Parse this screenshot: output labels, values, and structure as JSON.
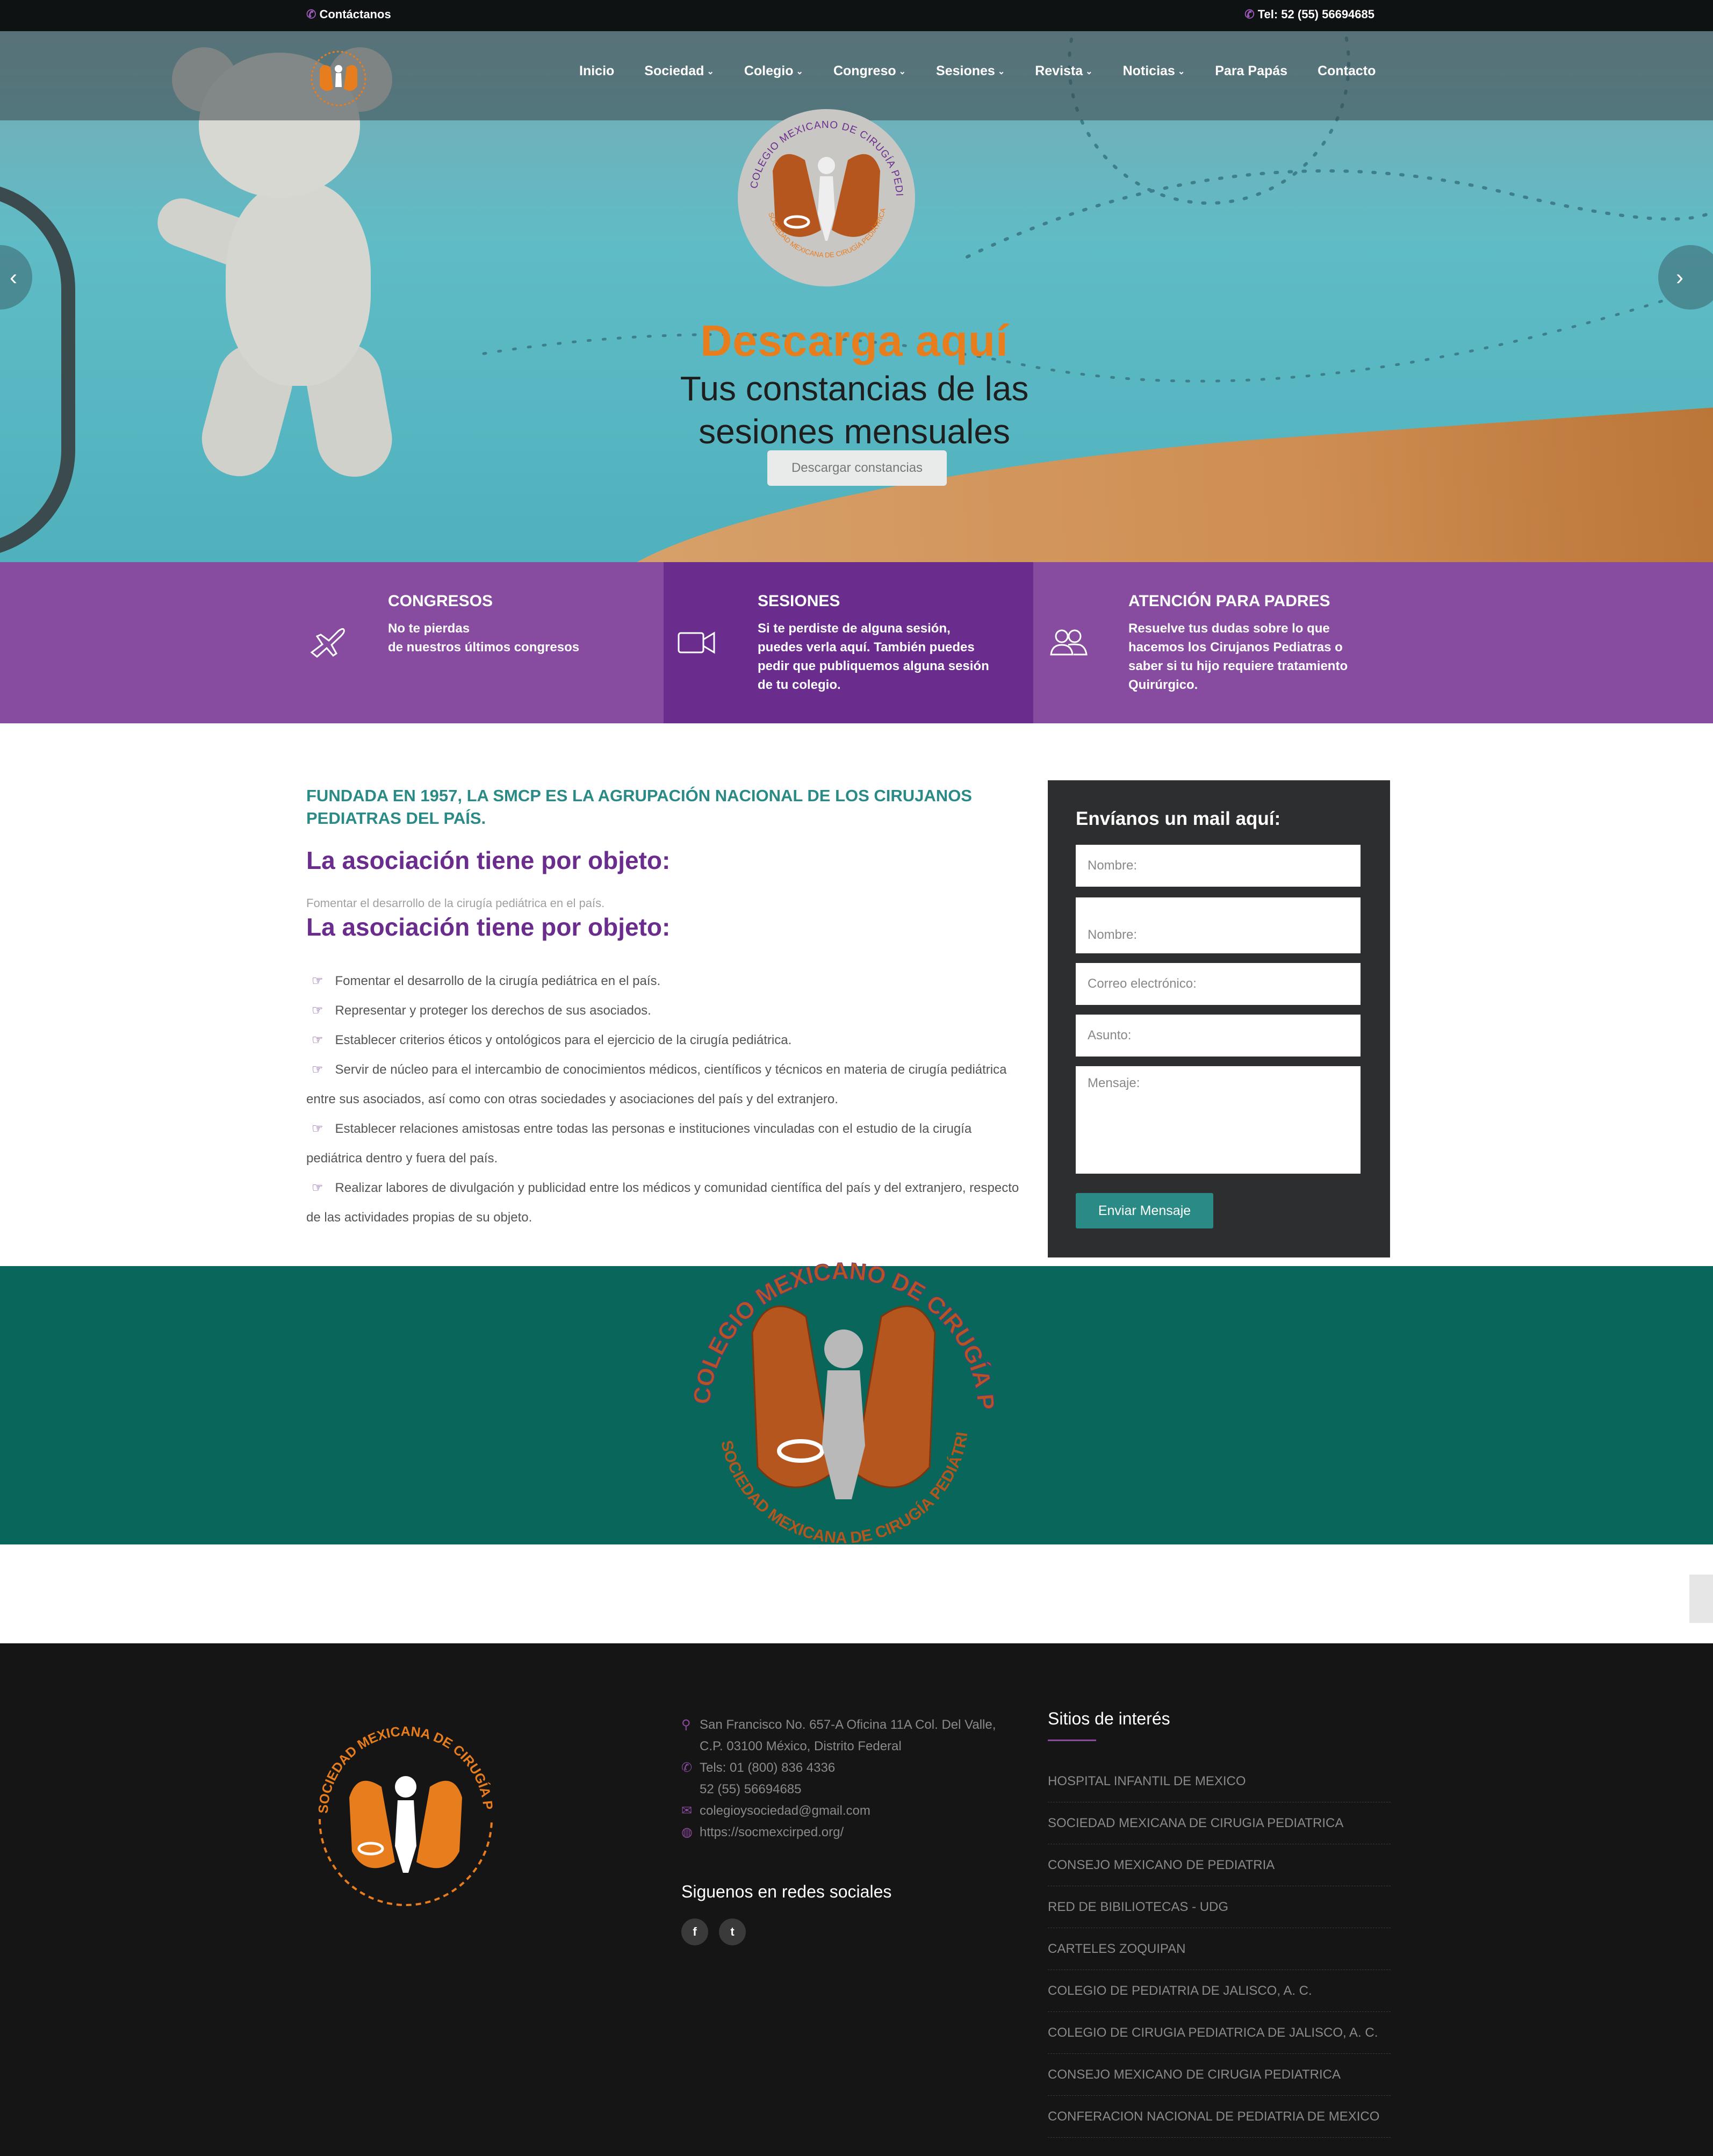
{
  "topbar": {
    "contact": "Contáctanos",
    "phone": "Tel: 52 (55) 56694685"
  },
  "nav": {
    "items": [
      {
        "label": "Inicio",
        "dropdown": false
      },
      {
        "label": "Sociedad",
        "dropdown": true
      },
      {
        "label": "Colegio",
        "dropdown": true
      },
      {
        "label": "Congreso",
        "dropdown": true
      },
      {
        "label": "Sesiones",
        "dropdown": true
      },
      {
        "label": "Revista",
        "dropdown": true
      },
      {
        "label": "Noticias",
        "dropdown": true
      },
      {
        "label": "Para Papás",
        "dropdown": false
      },
      {
        "label": "Contacto",
        "dropdown": false
      }
    ],
    "chevron": "⌄"
  },
  "hero": {
    "title": "Descarga aquí",
    "subtitle_line1": "Tus constancias de las",
    "subtitle_line2": "sesiones mensuales",
    "button": "Descargar constancias",
    "logo_text_top": "COLEGIO MEXICANO DE CIRUGÍA PEDIÁTRICA, A.C.",
    "logo_text_bottom": "SOCIEDAD MEXICANA DE CIRUGÍA PEDIÁTRICA, A.C."
  },
  "features": [
    {
      "title": "CONGRESOS",
      "text": [
        "No te pierdas",
        "de nuestros últimos congresos"
      ],
      "icon": "airplane-icon"
    },
    {
      "title": "SESIONES",
      "text": [
        "Si te perdiste de alguna sesión,",
        "puedes verla aquí. También puedes",
        "pedir que publiquemos alguna sesión",
        "de tu colegio."
      ],
      "icon": "video-camera-icon"
    },
    {
      "title": "ATENCIÓN PARA PADRES",
      "text": [
        "Resuelve tus dudas sobre lo que",
        "hacemos los Cirujanos Pediatras o",
        "saber si tu hijo requiere tratamiento",
        "Quirúrgico."
      ],
      "icon": "users-icon"
    }
  ],
  "about": {
    "tagline": "FUNDADA EN 1957, LA SMCP ES LA AGRUPACIÓN NACIONAL DE LOS CIRUJANOS PEDIATRAS DEL PAÍS.",
    "heading": "La asociación tiene por objeto:",
    "heading2": "La asociación tiene por objeto:",
    "items": [
      "Fomentar el desarrollo de la cirugía pediátrica en el país.",
      "Representar y proteger los derechos de sus asociados.",
      "Establecer criterios éticos y ontológicos para el ejercicio de la cirugía pediátrica.",
      "Servir de núcleo para el intercambio de conocimientos médicos, científicos y técnicos en materia de cirugía pediátrica entre sus asociados, así como con otras sociedades y asociaciones del país y del extranjero.",
      "Establecer relaciones amistosas entre todas las personas e instituciones vinculadas con el estudio de la cirugía pediátrica dentro y fuera del país.",
      "Realizar labores de divulgación y publicidad entre los médicos y comunidad científica del país y del extranjero, respecto de las actividades propias de su objeto."
    ]
  },
  "form": {
    "title": "Envíanos un mail aquí:",
    "name1": "Nombre:",
    "name2": "Nombre:",
    "email": "Correo electrónico:",
    "subject": "Asunto:",
    "message": "Mensaje:",
    "submit": "Enviar Mensaje"
  },
  "footer": {
    "logo_text": "SOCIEDAD MEXICANA DE CIRUGÍA PEDIÁTRICA, A.C.",
    "address_line1": "San Francisco No. 657-A Oficina 11A Col. Del Valle,",
    "address_line2": "C.P. 03100 México, Distrito Federal",
    "phone_line1": "Tels: 01 (800) 836 4336",
    "phone_line2": "52 (55) 56694685",
    "email": "colegioysociedad@gmail.com",
    "website": "https://socmexcirped.org/",
    "social_heading": "Siguenos en redes sociales",
    "social": [
      {
        "icon": "facebook-icon",
        "glyph": "f"
      },
      {
        "icon": "twitter-icon",
        "glyph": "t"
      }
    ],
    "sites_heading": "Sitios de interés",
    "sites": [
      "HOSPITAL INFANTIL DE MEXICO",
      "SOCIEDAD MEXICANA DE CIRUGIA PEDIATRICA",
      "CONSEJO MEXICANO DE PEDIATRIA",
      "RED DE BIBILIOTECAS - UDG",
      "CARTELES ZOQUIPAN",
      "COLEGIO DE PEDIATRIA DE JALISCO, A. C.",
      "COLEGIO DE CIRUGIA PEDIATRICA DE JALISCO, A. C.",
      "CONSEJO MEXICANO DE CIRUGIA PEDIATRICA",
      "CONFERACION NACIONAL DE PEDIATRIA DE MEXICO"
    ]
  },
  "colors": {
    "purple": "#874ba0",
    "purple_dark": "#6a2d8e",
    "teal": "#2a8a85",
    "band": "#08665a",
    "orange": "#e87d1e"
  }
}
